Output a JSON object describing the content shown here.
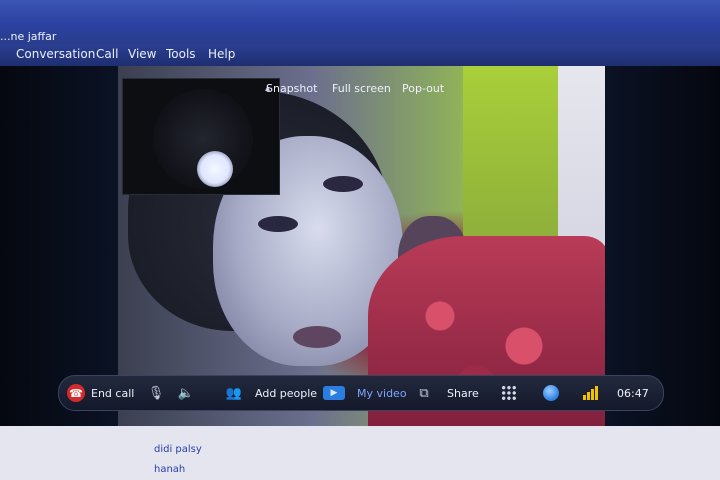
{
  "window": {
    "title": "...ne jaffar"
  },
  "menu": [
    "Conversation",
    "Call",
    "View",
    "Tools",
    "Help"
  ],
  "video_options": {
    "snapshot": "Snapshot",
    "full_screen": "Full screen",
    "pop_out": "Pop-out"
  },
  "toolbar": {
    "end_call": "End call",
    "add_people": "Add people",
    "my_video": "My video",
    "share": "Share",
    "time": "06:47",
    "signal_level": 4
  },
  "contacts": [
    "didi palsy",
    "hanah"
  ],
  "icons": [
    "end-call-icon",
    "microphone-icon",
    "speaker-icon",
    "add-people-icon",
    "video-camera-icon",
    "share-icon",
    "dialpad-icon",
    "globe-icon",
    "signal-icon"
  ],
  "colors": {
    "end_call": "#d32b2b",
    "accent_blue": "#7fa4ff",
    "signal": "#f2c200"
  }
}
